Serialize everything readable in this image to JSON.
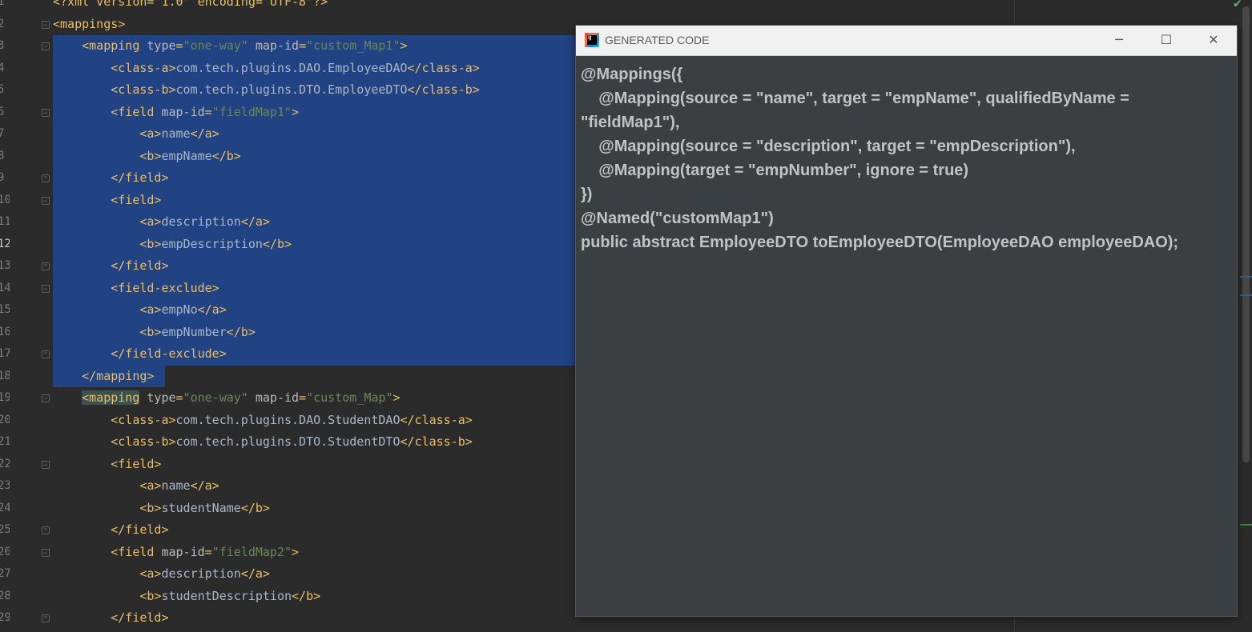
{
  "editor": {
    "lines": [
      {
        "num": "1",
        "selected": false,
        "tokens": [
          [
            "tag",
            "<?xml version=\"1.0\" encoding=\"UTF-8\"?>"
          ]
        ]
      },
      {
        "num": "2",
        "selected": false,
        "tokens": [
          [
            "tag",
            "<mappings>"
          ]
        ]
      },
      {
        "num": "3",
        "selected": true,
        "tokens": [
          [
            "txt",
            "    "
          ],
          [
            "tag",
            "<mapping "
          ],
          [
            "attr",
            "type"
          ],
          [
            "tag",
            "="
          ],
          [
            "aval",
            "\"one-way\""
          ],
          [
            "attr",
            " map-id"
          ],
          [
            "tag",
            "="
          ],
          [
            "aval",
            "\"custom_Map1\""
          ],
          [
            "tag",
            ">"
          ]
        ]
      },
      {
        "num": "4",
        "selected": true,
        "tokens": [
          [
            "txt",
            "        "
          ],
          [
            "tag",
            "<class-a>"
          ],
          [
            "txt",
            "com.tech.plugins.DAO.EmployeeDAO"
          ],
          [
            "tag",
            "</class-a>"
          ]
        ]
      },
      {
        "num": "5",
        "selected": true,
        "tokens": [
          [
            "txt",
            "        "
          ],
          [
            "tag",
            "<class-b>"
          ],
          [
            "txt",
            "com.tech.plugins.DTO.EmployeeDTO"
          ],
          [
            "tag",
            "</class-b>"
          ]
        ]
      },
      {
        "num": "6",
        "selected": true,
        "tokens": [
          [
            "txt",
            "        "
          ],
          [
            "tag",
            "<field "
          ],
          [
            "attr",
            "map-id"
          ],
          [
            "tag",
            "="
          ],
          [
            "aval",
            "\"fieldMap1\""
          ],
          [
            "tag",
            ">"
          ]
        ]
      },
      {
        "num": "7",
        "selected": true,
        "tokens": [
          [
            "txt",
            "            "
          ],
          [
            "tag",
            "<a>"
          ],
          [
            "txt",
            "name"
          ],
          [
            "tag",
            "</a>"
          ]
        ]
      },
      {
        "num": "8",
        "selected": true,
        "tokens": [
          [
            "txt",
            "            "
          ],
          [
            "tag",
            "<b>"
          ],
          [
            "txt",
            "empName"
          ],
          [
            "tag",
            "</b>"
          ]
        ]
      },
      {
        "num": "9",
        "selected": true,
        "tokens": [
          [
            "txt",
            "        "
          ],
          [
            "tag",
            "</field>"
          ]
        ]
      },
      {
        "num": "10",
        "selected": true,
        "tokens": [
          [
            "txt",
            "        "
          ],
          [
            "tag",
            "<field>"
          ]
        ]
      },
      {
        "num": "11",
        "selected": true,
        "tokens": [
          [
            "txt",
            "            "
          ],
          [
            "tag",
            "<a>"
          ],
          [
            "txt",
            "description"
          ],
          [
            "tag",
            "</a>"
          ]
        ]
      },
      {
        "num": "12",
        "selected": true,
        "tokens": [
          [
            "txt",
            "            "
          ],
          [
            "tag",
            "<b>"
          ],
          [
            "txt",
            "empDescription"
          ],
          [
            "tag",
            "</b>"
          ]
        ]
      },
      {
        "num": "13",
        "selected": true,
        "tokens": [
          [
            "txt",
            "        "
          ],
          [
            "tag",
            "</field>"
          ]
        ]
      },
      {
        "num": "14",
        "selected": true,
        "tokens": [
          [
            "txt",
            "        "
          ],
          [
            "tag",
            "<field-exclude>"
          ]
        ]
      },
      {
        "num": "15",
        "selected": true,
        "tokens": [
          [
            "txt",
            "            "
          ],
          [
            "tag",
            "<a>"
          ],
          [
            "txt",
            "empNo"
          ],
          [
            "tag",
            "</a>"
          ]
        ]
      },
      {
        "num": "16",
        "selected": true,
        "tokens": [
          [
            "txt",
            "            "
          ],
          [
            "tag",
            "<b>"
          ],
          [
            "txt",
            "empNumber"
          ],
          [
            "tag",
            "</b>"
          ]
        ]
      },
      {
        "num": "17",
        "selected": true,
        "tokens": [
          [
            "txt",
            "        "
          ],
          [
            "tag",
            "</field-exclude>"
          ]
        ]
      },
      {
        "num": "18",
        "selected": true,
        "tokens": [
          [
            "txt",
            "    "
          ],
          [
            "tag",
            "</mapping>"
          ]
        ]
      },
      {
        "num": "19",
        "selected": false,
        "tokens": [
          [
            "txt",
            "    "
          ],
          [
            "tag",
            "<mapping"
          ],
          [
            "attr",
            " type"
          ],
          [
            "tag",
            "="
          ],
          [
            "aval",
            "\"one-way\""
          ],
          [
            "attr",
            " map-id"
          ],
          [
            "tag",
            "="
          ],
          [
            "aval",
            "\"custom_Map\""
          ],
          [
            "tag",
            ">"
          ]
        ]
      },
      {
        "num": "20",
        "selected": false,
        "tokens": [
          [
            "txt",
            "        "
          ],
          [
            "tag",
            "<class-a>"
          ],
          [
            "txt",
            "com.tech.plugins.DAO.StudentDAO"
          ],
          [
            "tag",
            "</class-a>"
          ]
        ]
      },
      {
        "num": "21",
        "selected": false,
        "tokens": [
          [
            "txt",
            "        "
          ],
          [
            "tag",
            "<class-b>"
          ],
          [
            "txt",
            "com.tech.plugins.DTO.StudentDTO"
          ],
          [
            "tag",
            "</class-b>"
          ]
        ]
      },
      {
        "num": "22",
        "selected": false,
        "tokens": [
          [
            "txt",
            "        "
          ],
          [
            "tag",
            "<field>"
          ]
        ]
      },
      {
        "num": "23",
        "selected": false,
        "tokens": [
          [
            "txt",
            "            "
          ],
          [
            "tag",
            "<a>"
          ],
          [
            "txt",
            "name"
          ],
          [
            "tag",
            "</a>"
          ]
        ]
      },
      {
        "num": "24",
        "selected": false,
        "tokens": [
          [
            "txt",
            "            "
          ],
          [
            "tag",
            "<b>"
          ],
          [
            "txt",
            "studentName"
          ],
          [
            "tag",
            "</b>"
          ]
        ]
      },
      {
        "num": "25",
        "selected": false,
        "tokens": [
          [
            "txt",
            "        "
          ],
          [
            "tag",
            "</field>"
          ]
        ]
      },
      {
        "num": "26",
        "selected": false,
        "tokens": [
          [
            "txt",
            "        "
          ],
          [
            "tag",
            "<field "
          ],
          [
            "attr",
            "map-id"
          ],
          [
            "tag",
            "="
          ],
          [
            "aval",
            "\"fieldMap2\""
          ],
          [
            "tag",
            ">"
          ]
        ]
      },
      {
        "num": "27",
        "selected": false,
        "tokens": [
          [
            "txt",
            "            "
          ],
          [
            "tag",
            "<a>"
          ],
          [
            "txt",
            "description"
          ],
          [
            "tag",
            "</a>"
          ]
        ]
      },
      {
        "num": "28",
        "selected": false,
        "tokens": [
          [
            "txt",
            "            "
          ],
          [
            "tag",
            "<b>"
          ],
          [
            "txt",
            "studentDescription"
          ],
          [
            "tag",
            "</b>"
          ]
        ]
      },
      {
        "num": "29",
        "selected": false,
        "tokens": [
          [
            "txt",
            "        "
          ],
          [
            "tag",
            "</field>"
          ]
        ]
      }
    ]
  },
  "dialog": {
    "title": "GENERATED CODE",
    "app_icon_text": "IJ",
    "minimize_icon": "minimize-icon",
    "maximize_icon": "maximize-icon",
    "close_icon": "close-icon",
    "code_lines": [
      "@Mappings({",
      "    @Mapping(source = \"name\", target = \"empName\", qualifiedByName =",
      "\"fieldMap1\"),",
      "    @Mapping(source = \"description\", target = \"empDescription\"),",
      "    @Mapping(target = \"empNumber\", ignore = true)",
      "})",
      "@Named(\"customMap1\")",
      "public abstract EmployeeDTO toEmployeeDTO(EmployeeDAO employeeDAO);"
    ]
  },
  "colors": {
    "editor_bg": "#2b2b2b",
    "selection": "#214283",
    "tag": "#e8bf6a",
    "attr_value": "#6a8759",
    "dialog_bg": "#3c3f41",
    "dialog_text": "#c2c2c2"
  }
}
